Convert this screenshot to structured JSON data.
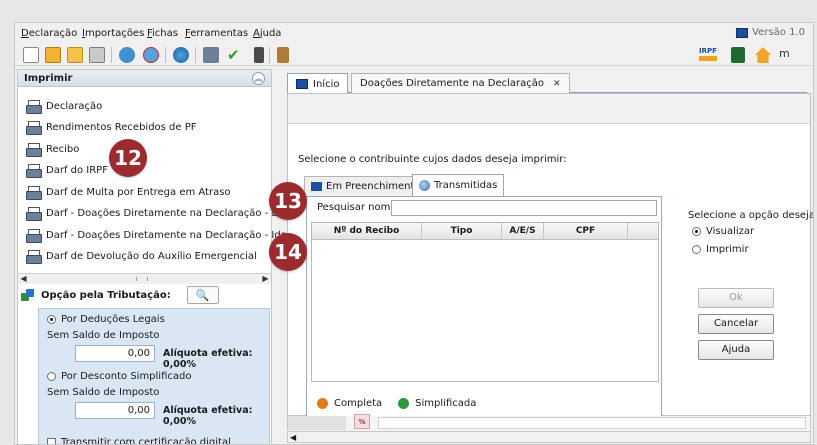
{
  "menu": [
    "Declaração",
    "Importações",
    "Fichas",
    "Ferramentas",
    "Ajuda"
  ],
  "version": "Versão 1.0",
  "toolbar_right": {
    "irpf": "IRPF"
  },
  "left_panel": {
    "title": "Imprimir",
    "items": [
      "Declaração",
      "Rendimentos Recebidos de PF",
      "Recibo",
      "Darf do IRPF",
      "Darf de Multa por Entrega em Atraso",
      "Darf - Doações Diretamente na Declaração - ECA",
      "Darf - Doações Diretamente na Declaração - Idoso",
      "Darf de Devolução do Auxílio Emergencial"
    ]
  },
  "tributacao": {
    "label": "Opção pela Tributação:",
    "deducoes": {
      "label": "Por Deduções Legais",
      "sub": "Sem Saldo de Imposto",
      "value": "0,00",
      "aliquota": "Alíquota efetiva: 0,00%"
    },
    "simplificado": {
      "label": "Por Desconto Simplificado",
      "sub": "Sem Saldo de Imposto",
      "value": "0,00",
      "aliquota": "Alíquota efetiva: 0,00%"
    },
    "certificado": "Transmitir com certificação digital"
  },
  "tabs": [
    "Início",
    "Doações Diretamente na Declaração"
  ],
  "content": {
    "instruction": "Selecione o contribuinte cujos dados deseja imprimir:",
    "inner_tabs": [
      "Em Preenchimento",
      "Transmitidas"
    ],
    "search_label": "Pesquisar nome:",
    "search_value": "",
    "columns": [
      "Nº do Recibo",
      "Tipo",
      "A/E/S",
      "CPF"
    ],
    "legend": [
      "Completa",
      "Simplificada"
    ]
  },
  "options": {
    "title": "Selecione a opção desejada:",
    "visualizar": "Visualizar",
    "imprimir": "Imprimir",
    "selected": "Visualizar"
  },
  "buttons": {
    "ok": "Ok",
    "cancelar": "Cancelar",
    "ajuda": "Ajuda"
  },
  "callouts": [
    "12",
    "13",
    "14"
  ],
  "colors": {
    "callout": "#9c2b2f",
    "accent": "#1d4f9e",
    "tax_box": "#d9e6f4"
  }
}
